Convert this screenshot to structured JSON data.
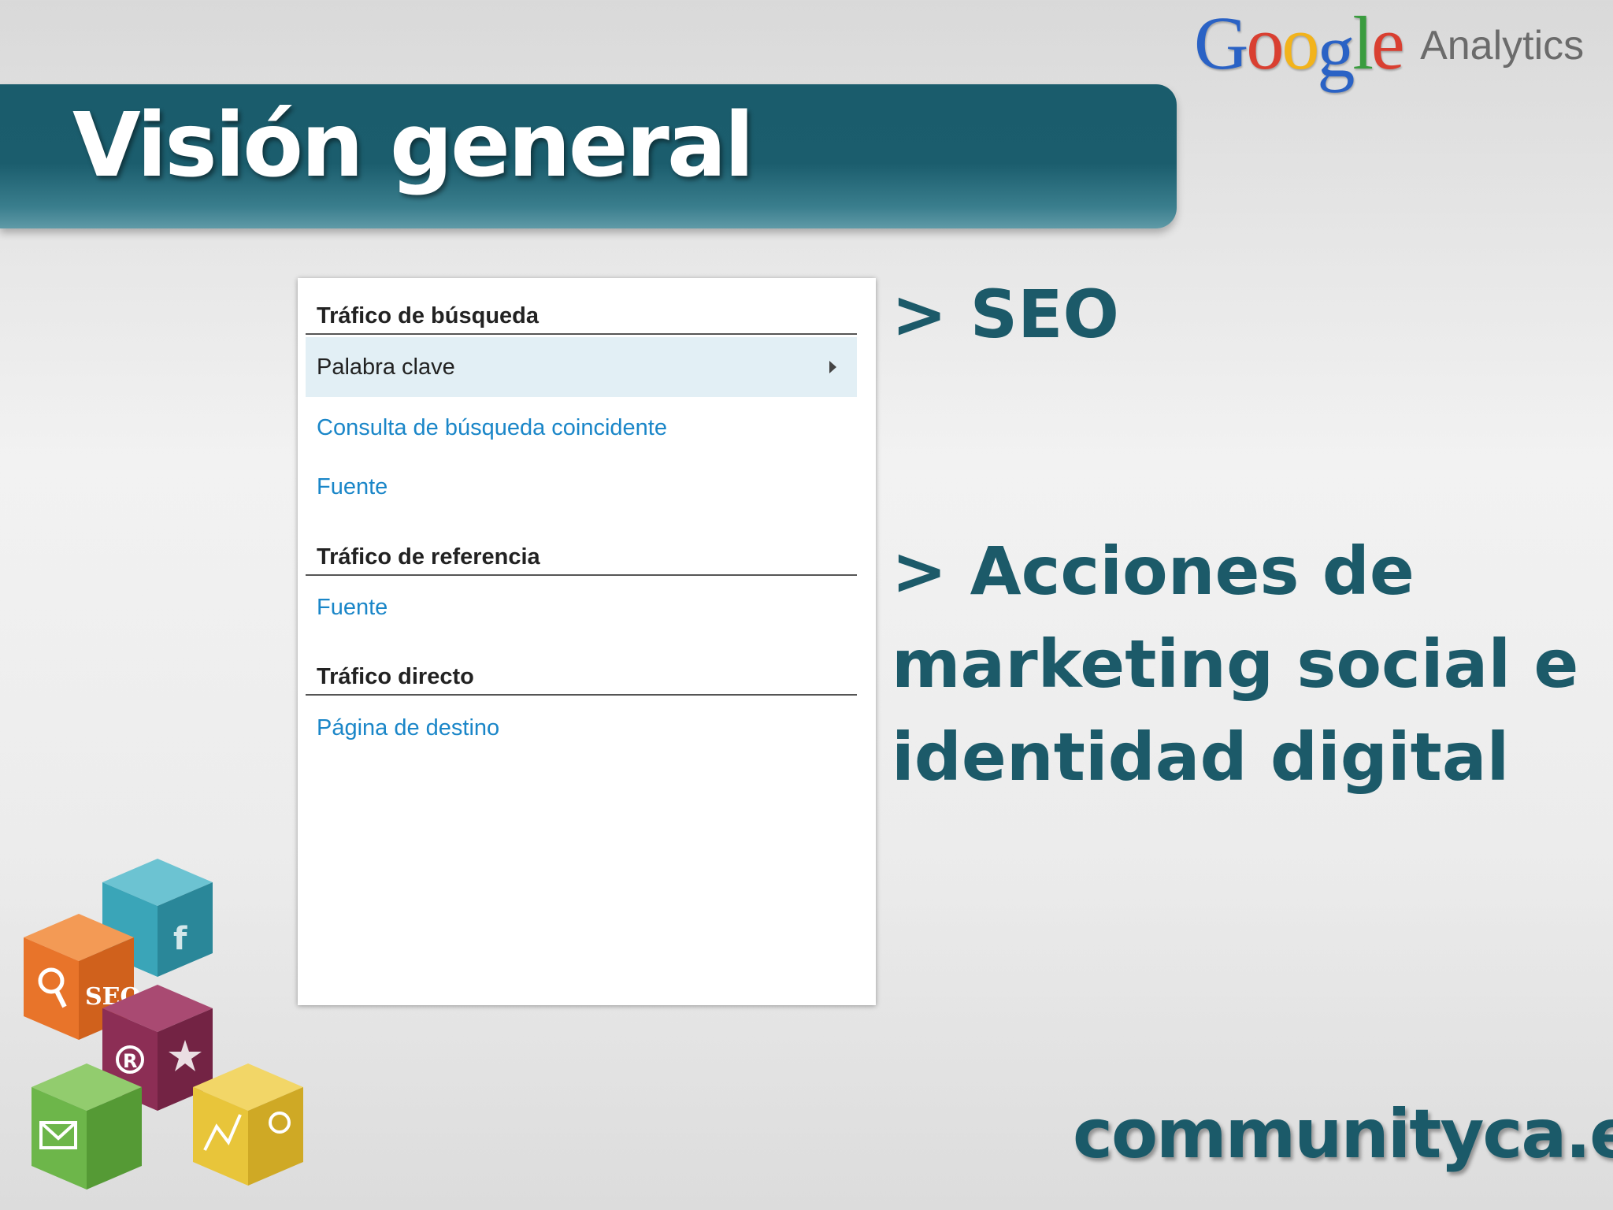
{
  "header": {
    "title": "Visión general"
  },
  "logo": {
    "google_letters": [
      {
        "ch": "G",
        "color": "#2a62c5"
      },
      {
        "ch": "o",
        "color": "#d93f31"
      },
      {
        "ch": "o",
        "color": "#f2b31b"
      },
      {
        "ch": "g",
        "color": "#2a62c5"
      },
      {
        "ch": "l",
        "color": "#3a9c3f"
      },
      {
        "ch": "e",
        "color": "#d93f31"
      }
    ],
    "product": "Analytics"
  },
  "panel": {
    "search_traffic": {
      "heading": "Tráfico de búsqueda",
      "items": [
        "Palabra clave",
        "Consulta de búsqueda coincidente",
        "Fuente"
      ]
    },
    "referral_traffic": {
      "heading": "Tráfico de referencia",
      "items": [
        "Fuente"
      ]
    },
    "direct_traffic": {
      "heading": "Tráfico directo",
      "items": [
        "Página de destino"
      ]
    }
  },
  "bullets": {
    "seo": "> SEO",
    "social_line1": "> Acciones de",
    "social_line2": "marketing social e",
    "social_line3": "identidad digital"
  },
  "footer": {
    "brand": "communityca.es"
  },
  "cubes": {
    "seo_label": "SEO",
    "colors": {
      "orange": "#e8742a",
      "teal": "#3aa5b8",
      "maroon": "#8c2e55",
      "green": "#6db64a",
      "yellow": "#e8c53a"
    }
  }
}
